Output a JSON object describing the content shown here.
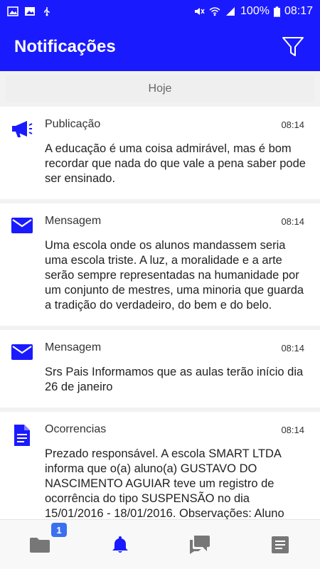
{
  "status_bar": {
    "battery": "100%",
    "time": "08:17",
    "icons": [
      "image-icon",
      "gallery-icon",
      "usb-icon",
      "mute-icon",
      "wifi-icon",
      "signal-icon",
      "battery-icon"
    ]
  },
  "app_bar": {
    "title": "Notificações",
    "filter_icon": "filter-icon"
  },
  "content": {
    "date_header": "Hoje",
    "notifications": [
      {
        "icon": "megaphone-icon",
        "type": "Publicação",
        "time": "08:14",
        "message": "A educação é uma coisa admirável, mas é bom recordar que nada do que vale a pena saber pode ser ensinado."
      },
      {
        "icon": "mail-icon",
        "type": "Mensagem",
        "time": "08:14",
        "message": "Uma escola onde os alunos mandassem seria uma escola triste. A luz, a moralidade e a arte serão sempre representadas na humanidade por um conjunto de mestres, uma minoria que guarda a tradição do verdadeiro, do bem e do belo."
      },
      {
        "icon": "mail-icon",
        "type": "Mensagem",
        "time": "08:14",
        "message": "Srs Pais Informamos que as aulas terão início dia 26 de janeiro"
      },
      {
        "icon": "document-icon",
        "type": "Ocorrencias",
        "time": "08:14",
        "message": "Prezado responsável. A escola SMART LTDA informa que o(a) aluno(a) GUSTAVO DO NASCIMENTO AGUIAR teve um registro de ocorrência do tipo SUSPENSÃO no dia 15/01/2016 - 18/01/2016. Observações: Aluno"
      }
    ]
  },
  "bottom_nav": {
    "items": [
      {
        "icon": "folder-icon",
        "badge": "1"
      },
      {
        "icon": "bell-icon",
        "active": true
      },
      {
        "icon": "chat-icon"
      },
      {
        "icon": "notes-icon"
      }
    ],
    "colors": {
      "active": "#1a1aff",
      "inactive": "#777777"
    }
  },
  "colors": {
    "primary": "#1a1aff",
    "badge": "#3a6ff0"
  }
}
